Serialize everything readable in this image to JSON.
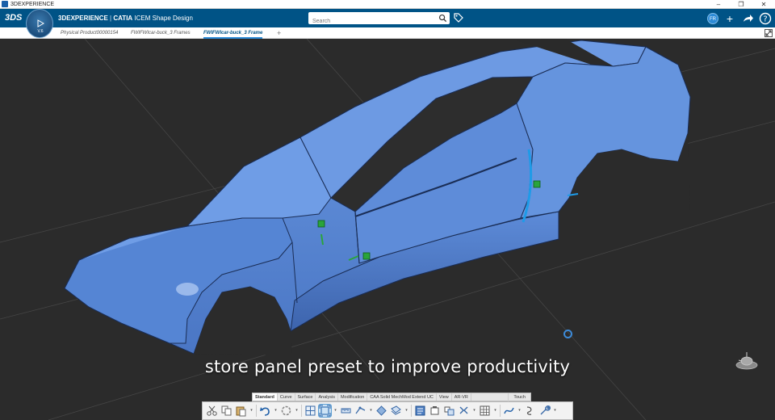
{
  "window": {
    "title": "3DEXPERIENCE",
    "controls": [
      "–",
      "❐",
      "✕"
    ]
  },
  "app": {
    "brand_bold": "3D",
    "brand_rest": "EXPERIENCE",
    "separator": " | ",
    "product": "CATIA",
    "module": " ICEM Shape Design",
    "logo_text": "3DS",
    "search_placeholder": "Search",
    "user_initials": "FR",
    "compass_version": "V.6"
  },
  "tabs": [
    {
      "label": "Physical Product00000154",
      "active": false
    },
    {
      "label": "FWIFWIcar-buck_3 Frames",
      "active": false
    },
    {
      "label": "FWIFWIcar-buck_3 Frame",
      "active": true
    }
  ],
  "tab_add_label": "+",
  "caption": "store panel preset to improve productivity",
  "action_bar": {
    "sections": [
      {
        "label": "Standard",
        "active": true
      },
      {
        "label": "Curve",
        "active": false
      },
      {
        "label": "Surface",
        "active": false
      },
      {
        "label": "Analysis",
        "active": false
      },
      {
        "label": "Modification",
        "active": false
      },
      {
        "label": "CAA Solid MechMod Extend UC",
        "active": false
      },
      {
        "label": "View",
        "active": false
      },
      {
        "label": "AR-VR",
        "active": false
      }
    ],
    "touch_label": "Touch",
    "tools": [
      "cut-icon",
      "copy-icon",
      "paste-icon",
      "undo-icon",
      "update-icon",
      "multi-view-icon",
      "fit-all-icon",
      "measure-icon",
      "normal-view-icon",
      "rotate-icon",
      "sheet-icon",
      "catalog-icon",
      "knowledge-icon",
      "plane-icon",
      "table-icon",
      "curve-icon",
      "hook-icon",
      "wrench-icon"
    ]
  },
  "colors": {
    "app_bar": "#005386",
    "viewport": "#2b2b2b",
    "car_body": "#5b8ad8",
    "highlight": "#1e9be8",
    "handle": "#2aa43b"
  }
}
